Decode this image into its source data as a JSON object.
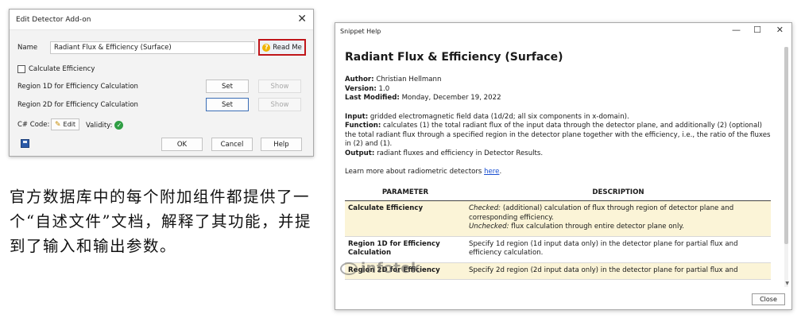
{
  "editor": {
    "title": "Edit Detector Add-on",
    "name_label": "Name",
    "name_value": "Radiant Flux & Efficiency (Surface)",
    "readme_label": "Read Me",
    "calc_eff_label": "Calculate Efficiency",
    "region1d_label": "Region 1D for Efficiency Calculation",
    "region2d_label": "Region 2D for Efficiency Calculation",
    "set_label": "Set",
    "show_label": "Show",
    "csharp_label": "C# Code:",
    "edit_label": "Edit",
    "validity_label": "Validity:",
    "ok_label": "OK",
    "cancel_label": "Cancel",
    "help_label": "Help"
  },
  "caption": "官方数据库中的每个附加组件都提供了一个“自述文件”文档，解释了其功能，并提到了输入和输出参数。",
  "help": {
    "title": "Snippet Help",
    "heading": "Radiant Flux & Efficiency (Surface)",
    "author_label": "Author:",
    "author": "Christian Hellmann",
    "version_label": "Version:",
    "version": "1.0",
    "modified_label": "Last Modified:",
    "modified": "Monday, December 19, 2022",
    "input_label": "Input:",
    "input": "gridded electromagnetic field data (1d/2d; all six components in x-domain).",
    "function_label": "Function:",
    "function": "calculates (1) the total radiant flux of the input data through the detector plane, and additionally (2) (optional) the total radiant flux through a specified region in the detector plane together with the efficiency, i.e., the ratio of the fluxes in (2) and (1).",
    "output_label": "Output:",
    "output": "radiant fluxes and efficiency in Detector Results.",
    "learn_more": "Learn more about radiometric detectors",
    "learn_link": "here",
    "learn_end": ".",
    "col_param": "PARAMETER",
    "col_desc": "DESCRIPTION",
    "rows": [
      {
        "name": "Calculate Efficiency",
        "checked_label": "Checked:",
        "checked": "(additional) calculation of flux through region of detector plane and corresponding efficiency.",
        "unchecked_label": "Unchecked:",
        "unchecked": "flux calculation through entire detector plane only."
      },
      {
        "name": "Region 1D for Efficiency Calculation",
        "desc": "Specify 1d region (1d input data only) in the detector plane for partial flux and efficiency calculation."
      },
      {
        "name": "Region 2D for Efficiency",
        "desc": "Specify 2d region (2d input data only) in the detector plane for partial flux and"
      }
    ],
    "close_label": "Close",
    "watermark": "infotek"
  }
}
